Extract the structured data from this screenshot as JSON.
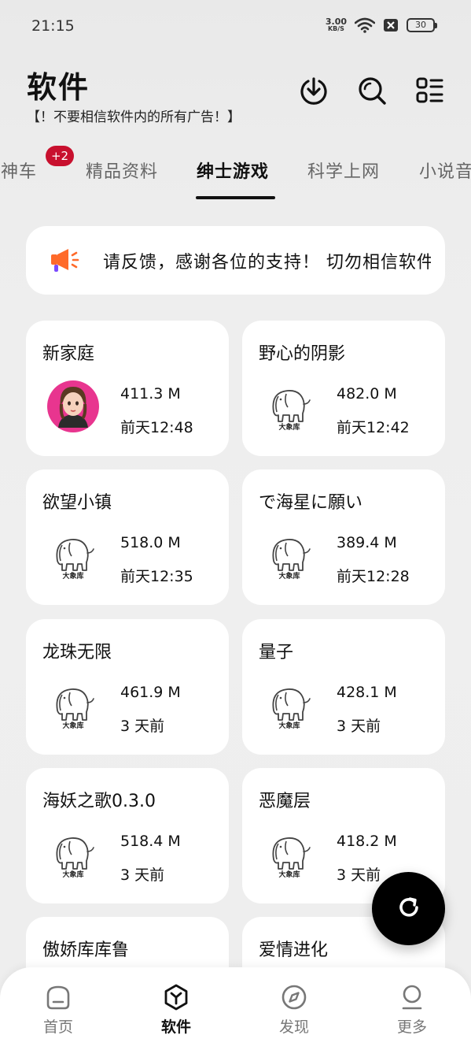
{
  "status_bar": {
    "time": "21:15",
    "net_speed": "3.00",
    "net_unit": "KB/S",
    "battery": "30"
  },
  "header": {
    "title": "软件",
    "subtitle": "【！不要相信软件内的所有广告！】",
    "icons": [
      "download-icon",
      "search-icon",
      "list-menu-icon"
    ]
  },
  "tabs": {
    "items": [
      "时神车",
      "精品资料",
      "绅士游戏",
      "科学上网",
      "小说音"
    ],
    "active": "绅士游戏",
    "badge": "+2"
  },
  "notice": {
    "text": "请反馈，感谢各位的支持！  切勿相信软件内的所有广告！"
  },
  "apps": [
    {
      "name": "新家庭",
      "size": "411.3 M",
      "time": "前天12:48",
      "thumb": "avatar"
    },
    {
      "name": "野心的阴影",
      "size": "482.0 M",
      "time": "前天12:42",
      "thumb": "elephant"
    },
    {
      "name": "欲望小镇",
      "size": "518.0 M",
      "time": "前天12:35",
      "thumb": "elephant"
    },
    {
      "name": "で海星に願い",
      "size": "389.4 M",
      "time": "前天12:28",
      "thumb": "elephant"
    },
    {
      "name": "龙珠无限",
      "size": "461.9 M",
      "time": "3 天前",
      "thumb": "elephant"
    },
    {
      "name": "量子",
      "size": "428.1 M",
      "time": "3 天前",
      "thumb": "elephant"
    },
    {
      "name": "海妖之歌0.3.0",
      "size": "518.4 M",
      "time": "3 天前",
      "thumb": "elephant"
    },
    {
      "name": "恶魔层",
      "size": "418.2 M",
      "time": "3 天前",
      "thumb": "elephant"
    },
    {
      "name": "傲娇库库鲁",
      "size": "",
      "time": "",
      "thumb": "none"
    },
    {
      "name": "爱情进化",
      "size": "",
      "time": "",
      "thumb": "none"
    }
  ],
  "thumb_logo_text": "大象库",
  "bottom_nav": [
    {
      "label": "首页",
      "icon": "home-icon"
    },
    {
      "label": "软件",
      "icon": "software-icon",
      "active": true
    },
    {
      "label": "发现",
      "icon": "compass-icon"
    },
    {
      "label": "更多",
      "icon": "profile-icon"
    }
  ],
  "colors": {
    "badge": "#c8102e",
    "accent": "#111111",
    "avatar_bg": "#e8358f",
    "notice_icon": "#ff6a2a"
  }
}
